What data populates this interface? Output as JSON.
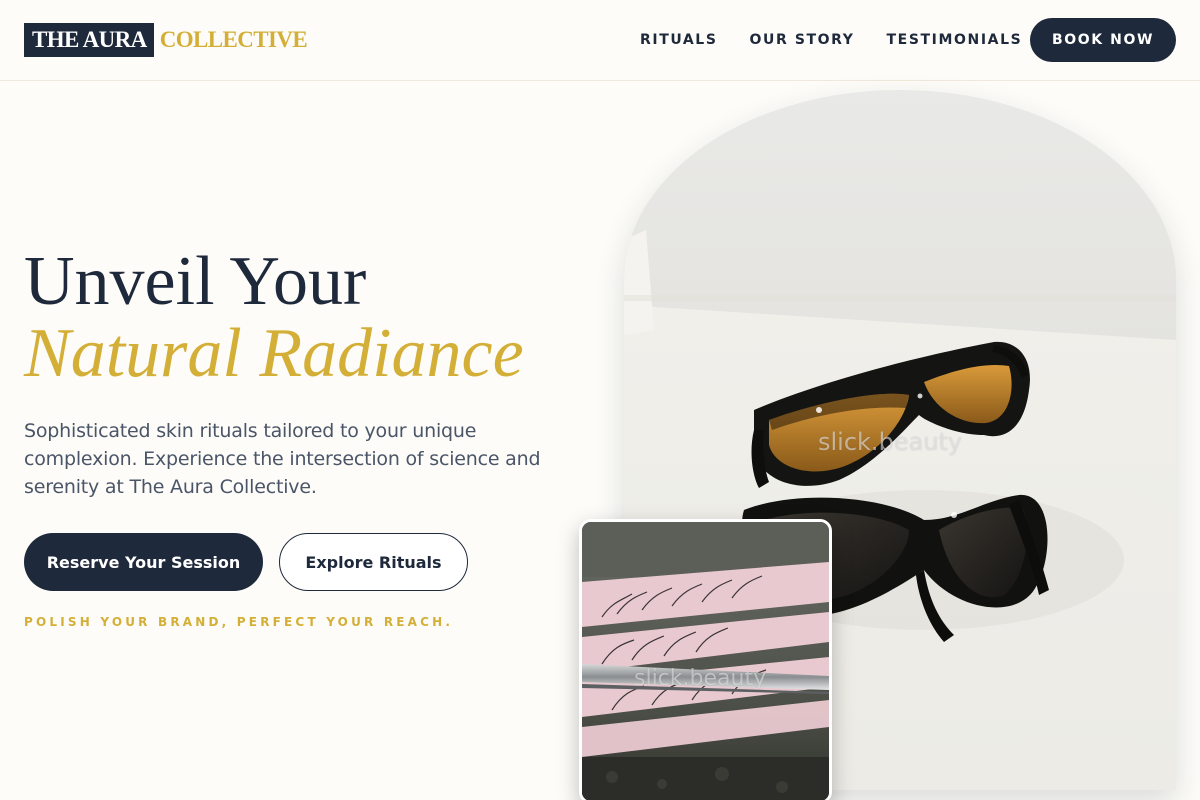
{
  "header": {
    "logo": {
      "part1": "THE AURA",
      "part2": "COLLECTIVE"
    },
    "nav": [
      {
        "label": "RITUALS"
      },
      {
        "label": "OUR STORY"
      },
      {
        "label": "TESTIMONIALS"
      }
    ],
    "book_label": "BOOK NOW"
  },
  "hero": {
    "headline_line1": "Unveil Your",
    "headline_line2": "Natural Radiance",
    "subtitle": "Sophisticated skin rituals tailored to your unique complexion. Experience the intersection of science and serenity at The Aura Collective.",
    "primary_button": "Reserve Your Session",
    "secondary_button": "Explore Rituals",
    "tagline": "POLISH YOUR BRAND, PERFECT YOUR REACH."
  },
  "images": {
    "main_watermark": "slick.beauty",
    "inset_watermark": "slick.beauty"
  },
  "colors": {
    "navy": "#1e293b",
    "gold": "#d4af37",
    "background": "#fdfcf8",
    "text_muted": "#4a5568"
  }
}
